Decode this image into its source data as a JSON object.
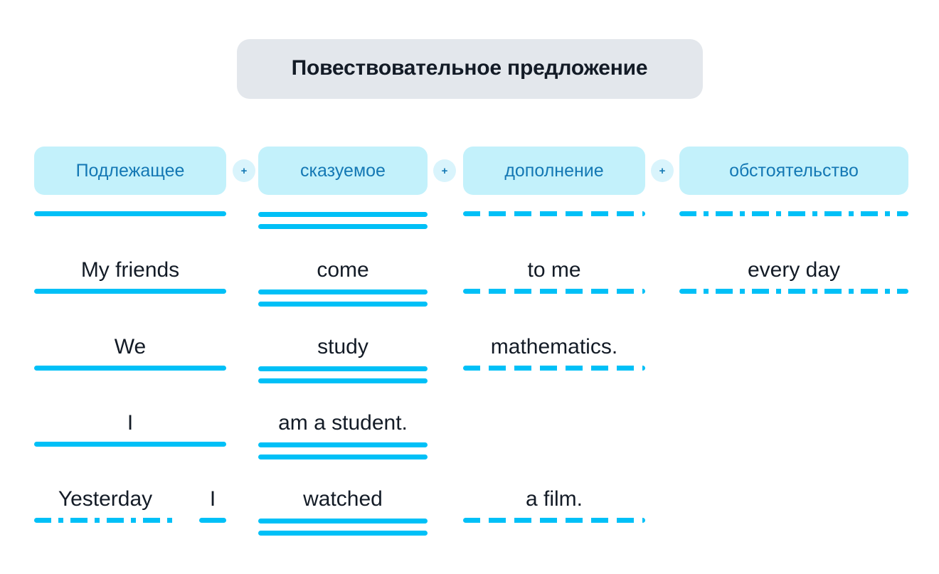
{
  "title": {
    "text": "Повествовательное предложение"
  },
  "colors": {
    "accent_line": "#00c0f7",
    "chip_bg": "#c3f1fb",
    "chip_text": "#1478b4",
    "badge_bg": "#d9f4fc",
    "title_bg": "#e3e7ec",
    "text": "#131b26",
    "page_bg": "#ffffff"
  },
  "formula": {
    "parts": [
      {
        "label": "Подлежащее",
        "underline": "solid"
      },
      {
        "label": "сказуемое",
        "underline": "double"
      },
      {
        "label": "дополнение",
        "underline": "dashed"
      },
      {
        "label": "обстоятельство",
        "underline": "dash-dot"
      }
    ],
    "separators": [
      "+",
      "+",
      "+"
    ]
  },
  "examples": [
    {
      "subject": "My friends",
      "predicate": "come",
      "object": "to me",
      "adverbial": "every day"
    },
    {
      "subject": "We",
      "predicate": "study",
      "object": "mathematics.",
      "adverbial": ""
    },
    {
      "subject": "I",
      "predicate": "am a student.",
      "object": "",
      "adverbial": ""
    },
    {
      "subject": "I",
      "predicate": "watched",
      "object": "a film.",
      "adverbial": "Yesterday",
      "adverbial_leading": true
    }
  ]
}
